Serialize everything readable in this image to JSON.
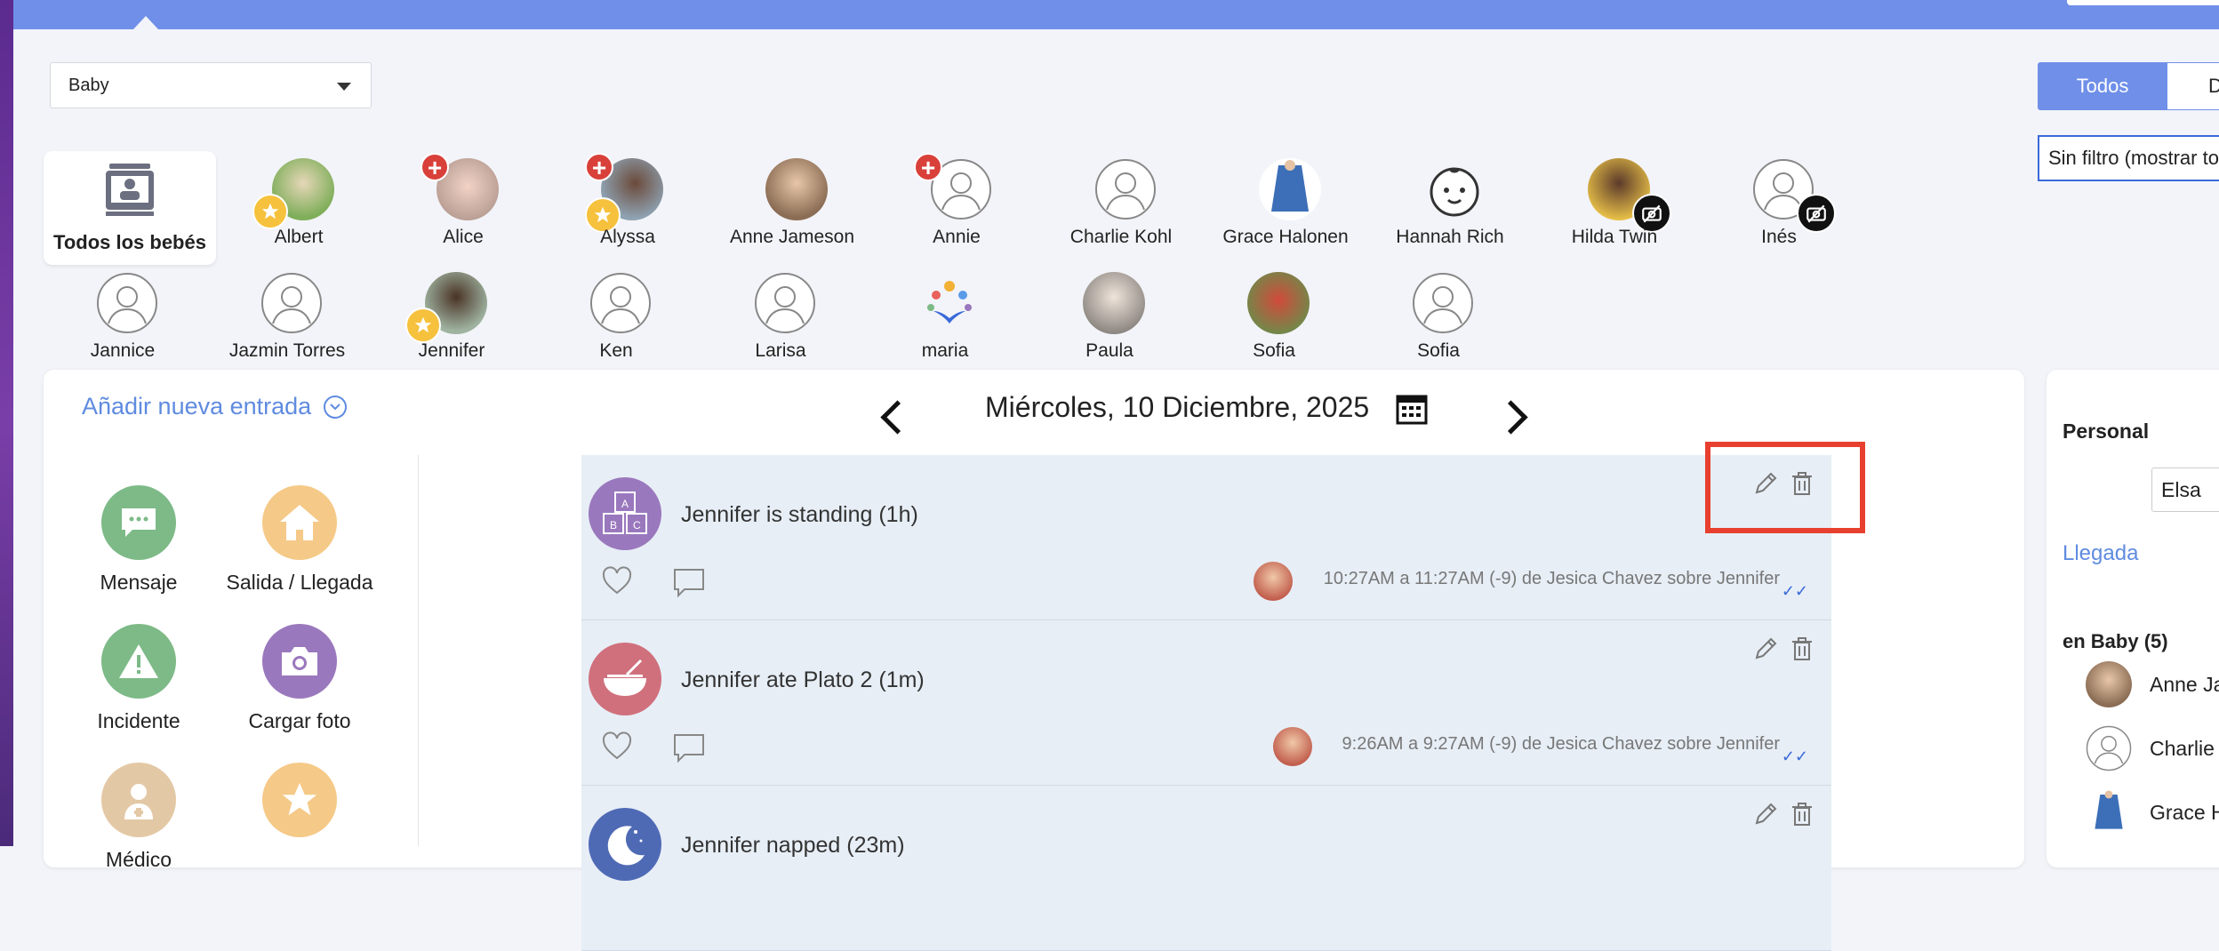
{
  "room_selector": {
    "value": "Baby"
  },
  "filter_segment": {
    "all": "Todos",
    "second": "D"
  },
  "filter_dropdown": {
    "value": "Sin filtro (mostrar to"
  },
  "all_babies": {
    "label": "Todos los bebés"
  },
  "children_row1": [
    {
      "name": "Albert",
      "badge": "star",
      "avatar": "photo"
    },
    {
      "name": "Alice",
      "badge": "plus",
      "avatar": "photo"
    },
    {
      "name": "Alyssa",
      "badge": "plus+star",
      "avatar": "photo"
    },
    {
      "name": "Anne Jameson",
      "badge": "",
      "avatar": "photo"
    },
    {
      "name": "Annie",
      "badge": "plus",
      "avatar": "placeholder"
    },
    {
      "name": "Charlie Kohl",
      "badge": "",
      "avatar": "placeholder"
    },
    {
      "name": "Grace Halonen",
      "badge": "",
      "avatar": "photo"
    },
    {
      "name": "Hannah Rich",
      "badge": "",
      "avatar": "baby-face"
    },
    {
      "name": "Hilda Twin",
      "badge": "no-photo",
      "avatar": "photo"
    },
    {
      "name": "Inés",
      "badge": "no-photo",
      "avatar": "placeholder"
    }
  ],
  "children_row2": [
    {
      "name": "Jannice",
      "avatar": "placeholder"
    },
    {
      "name": "Jazmin Torres",
      "avatar": "placeholder"
    },
    {
      "name": "Jennifer",
      "avatar": "photo",
      "badge": "star"
    },
    {
      "name": "Ken",
      "avatar": "placeholder"
    },
    {
      "name": "Larisa",
      "avatar": "placeholder"
    },
    {
      "name": "maria",
      "avatar": "logo"
    },
    {
      "name": "Paula",
      "avatar": "photo"
    },
    {
      "name": "Sofia",
      "avatar": "photo"
    },
    {
      "name": "Sofia",
      "avatar": "placeholder"
    }
  ],
  "add_entry": {
    "label": "Añadir nueva entrada"
  },
  "actions": [
    {
      "label": "Mensaje",
      "color": "#7dba87",
      "icon": "chat-icon"
    },
    {
      "label": "Salida / Llegada",
      "color": "#f5c987",
      "icon": "home-icon"
    },
    {
      "label": "Incidente",
      "color": "#7dba87",
      "icon": "warning-icon"
    },
    {
      "label": "Cargar foto",
      "color": "#9a78bd",
      "icon": "camera-icon"
    },
    {
      "label": "Médico",
      "color": "#e3c8a5",
      "icon": "doctor-icon"
    },
    {
      "label": "",
      "color": "#f5c987",
      "icon": "star-icon"
    }
  ],
  "date_nav": {
    "date": "Miércoles, 10 Diciembre, 2025"
  },
  "entries": [
    {
      "title": "Jennifer is standing (1h)",
      "meta": "10:27AM a 11:27AM (-9) de Jesica Chavez sobre Jennifer",
      "icon": "blocks-icon",
      "color": "#9a78bd",
      "ticks": "✓✓"
    },
    {
      "title": "Jennifer ate Plato 2 (1m)",
      "meta": "9:26AM a 9:27AM (-9) de Jesica Chavez sobre Jennifer",
      "icon": "bowl-icon",
      "color": "#d0707c",
      "ticks": "✓✓"
    },
    {
      "title": "Jennifer napped (23m)",
      "meta": "",
      "icon": "moon-icon",
      "color": "#4f6ab5",
      "ticks": ""
    }
  ],
  "right_panel": {
    "heading": "Personal",
    "staff_value": "Elsa",
    "link": "Llegada",
    "room_count": "en Baby (5)",
    "people": [
      "Anne Ja",
      "Charlie",
      "Grace H"
    ]
  },
  "colors": {
    "accent": "#6f8fe8",
    "link": "#5f8be0",
    "danger": "#e8402f",
    "entry_bg": "#e7eef6"
  }
}
